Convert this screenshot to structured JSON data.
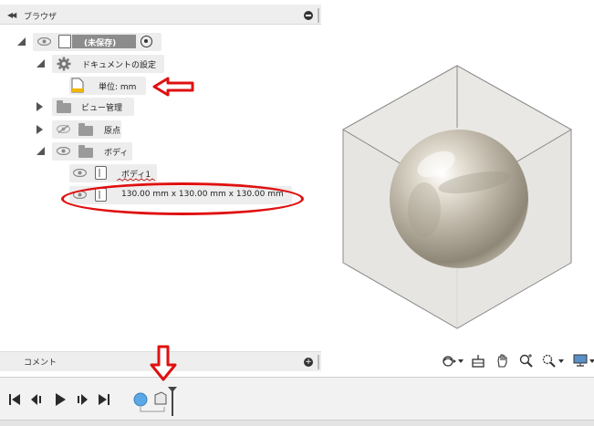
{
  "browser": {
    "title": "ブラウザ",
    "root": {
      "label": "(未保存)"
    },
    "doc_settings": {
      "label": "ドキュメントの設定"
    },
    "units": {
      "label": "単位: mm"
    },
    "view_mgmt": {
      "label": "ビュー管理"
    },
    "origin": {
      "label": "原点"
    },
    "bodies": {
      "label": "ボディ"
    },
    "body1": {
      "label": "ボディ1"
    },
    "dimension": {
      "label": "130.00 mm x 130.00 mm x 130.00 mm"
    }
  },
  "comments": {
    "label": "コメント"
  },
  "colors": {
    "annotation": "#e01010",
    "panel": "#eeeeee",
    "sphere": "#c8c2b4"
  },
  "icons": [
    "collapse-icon",
    "eye-icon",
    "gear-icon",
    "folder-icon",
    "document-icon",
    "body-icon",
    "orbit-icon",
    "look-at-icon",
    "pan-icon",
    "zoom-icon",
    "fit-icon",
    "display-icon"
  ]
}
